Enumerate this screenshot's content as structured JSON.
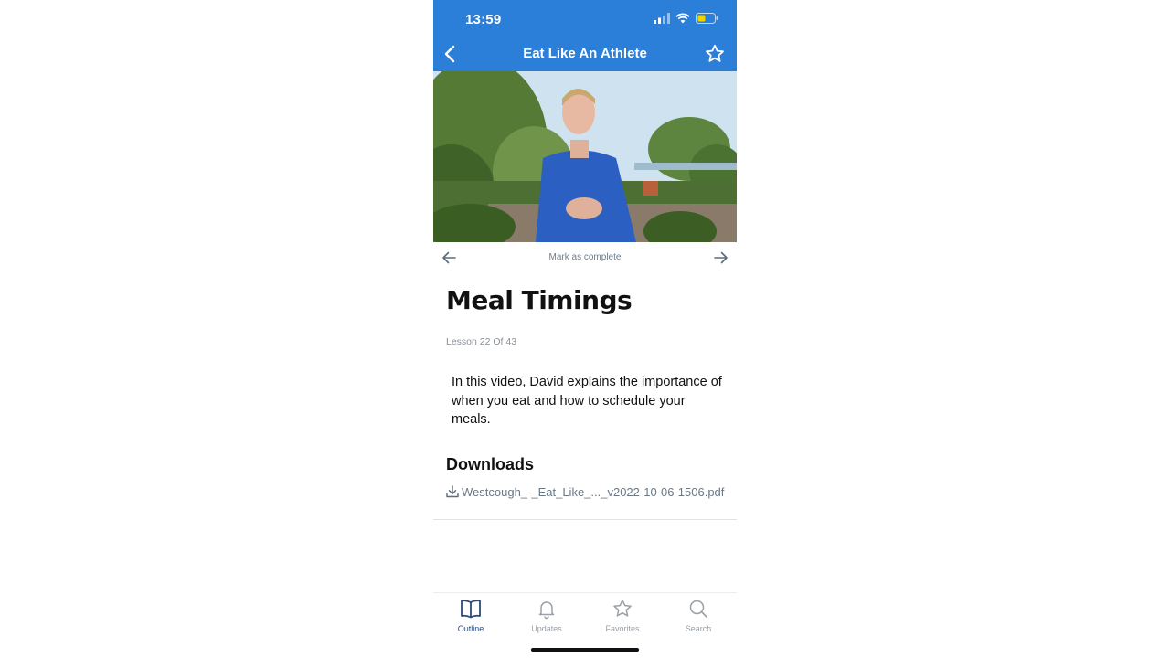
{
  "status": {
    "time": "13:59",
    "icons": [
      "signal-icon",
      "wifi-icon",
      "battery-icon"
    ]
  },
  "nav": {
    "title": "Eat Like An Athlete",
    "back_icon": "chevron-left-icon",
    "favorite_icon": "star-icon"
  },
  "lesson_nav": {
    "mark_complete": "Mark as complete",
    "prev_icon": "arrow-left-icon",
    "next_icon": "arrow-right-icon"
  },
  "lesson": {
    "title": "Meal Timings",
    "counter": "Lesson 22 Of 43",
    "description": "In this video, David explains the importance of when you eat and how to schedule your meals."
  },
  "downloads": {
    "title": "Downloads",
    "files": [
      {
        "name": "Westcough_-_Eat_Like_..._v2022-10-06-1506.pdf",
        "icon": "download-icon"
      }
    ]
  },
  "tabs": [
    {
      "label": "Outline",
      "icon": "book-icon",
      "active": true
    },
    {
      "label": "Updates",
      "icon": "bell-icon",
      "active": false
    },
    {
      "label": "Favorites",
      "icon": "star-icon",
      "active": false
    },
    {
      "label": "Search",
      "icon": "search-icon",
      "active": false
    }
  ],
  "colors": {
    "header_bg": "#2b7fd9",
    "active_tab": "#2c4a7c",
    "inactive_tab": "#9aa0a6",
    "battery_fill": "#f5d100"
  }
}
